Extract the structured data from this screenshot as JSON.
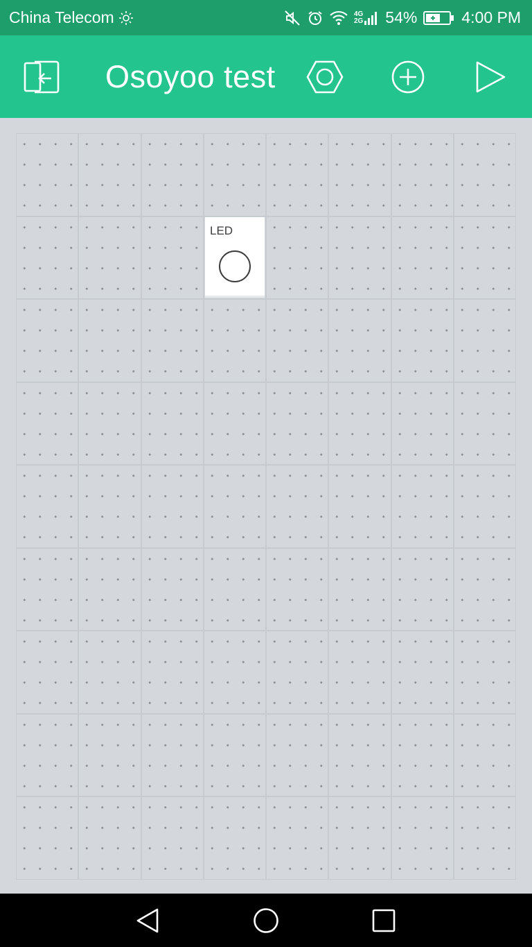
{
  "status_bar": {
    "carrier": "China Telecom",
    "network_top": "4G",
    "network_bottom": "2G",
    "battery": "54%",
    "time": "4:00 PM",
    "icons": [
      "brightness-icon",
      "mute-icon",
      "alarm-icon",
      "wifi-icon",
      "signal-icon",
      "battery-charging-icon"
    ]
  },
  "app_bar": {
    "title": "Osoyoo test",
    "accent_color": "#23c48e",
    "icons": [
      "exit-icon",
      "settings-hex-icon",
      "add-widget-icon",
      "play-icon"
    ]
  },
  "canvas": {
    "columns": 8,
    "rows": 9
  },
  "widgets": [
    {
      "type": "led",
      "label": "LED",
      "icon": "led-indicator-icon"
    }
  ],
  "nav_bar": {
    "icons": [
      "back-icon",
      "home-icon",
      "recents-icon"
    ]
  }
}
